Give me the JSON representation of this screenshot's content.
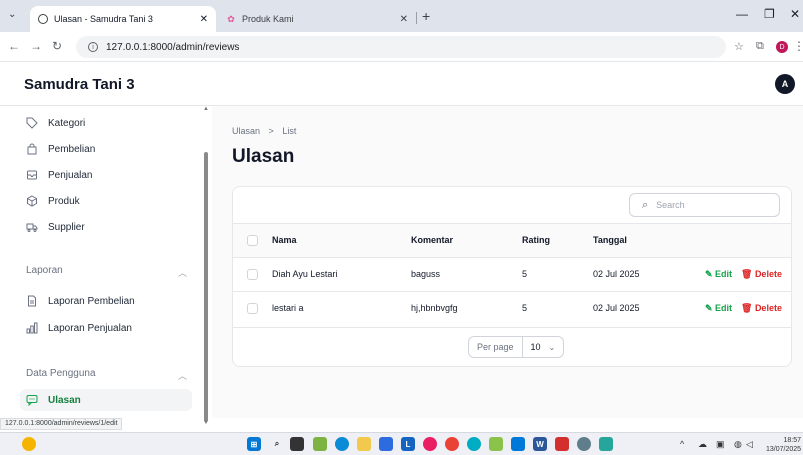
{
  "browser": {
    "tabs": [
      {
        "title": "Ulasan - Samudra Tani 3",
        "active": true
      },
      {
        "title": "Produk Kami",
        "active": false
      }
    ],
    "url": "127.0.0.1:8000/admin/reviews",
    "status_url": "127.0.0.1:8000/admin/reviews/1/edit",
    "profile_initial": "D"
  },
  "app": {
    "brand": "Samudra Tani 3",
    "avatar_initial": "A"
  },
  "sidebar": {
    "items": [
      {
        "label": "Kategori",
        "icon": "tag-icon"
      },
      {
        "label": "Pembelian",
        "icon": "shopping-bag-icon"
      },
      {
        "label": "Penjualan",
        "icon": "inbox-icon"
      },
      {
        "label": "Produk",
        "icon": "cube-icon"
      },
      {
        "label": "Supplier",
        "icon": "truck-icon"
      }
    ],
    "groups": [
      {
        "label": "Laporan",
        "items": [
          {
            "label": "Laporan Pembelian",
            "icon": "document-icon"
          },
          {
            "label": "Laporan Penjualan",
            "icon": "bar-chart-icon"
          }
        ]
      },
      {
        "label": "Data Pengguna",
        "items": [
          {
            "label": "Ulasan",
            "icon": "chat-bubble-icon",
            "active": true
          }
        ]
      }
    ]
  },
  "main": {
    "breadcrumb": [
      "Ulasan",
      "List"
    ],
    "title": "Ulasan",
    "search_placeholder": "Search",
    "columns": [
      "Nama",
      "Komentar",
      "Rating",
      "Tanggal"
    ],
    "rows": [
      {
        "nama": "Diah Ayu Lestari",
        "komentar": "baguss",
        "rating": "5",
        "tanggal": "02 Jul 2025"
      },
      {
        "nama": "lestari a",
        "komentar": "hj,hbnbvgfg",
        "rating": "5",
        "tanggal": "02 Jul 2025"
      }
    ],
    "edit_label": "Edit",
    "delete_label": "Delete",
    "per_page_label": "Per page",
    "per_page_value": "10"
  },
  "taskbar": {
    "time": "18:57",
    "date": "13/07/2025"
  },
  "colors": {
    "accent": "#16a34a",
    "danger": "#dc2626"
  }
}
